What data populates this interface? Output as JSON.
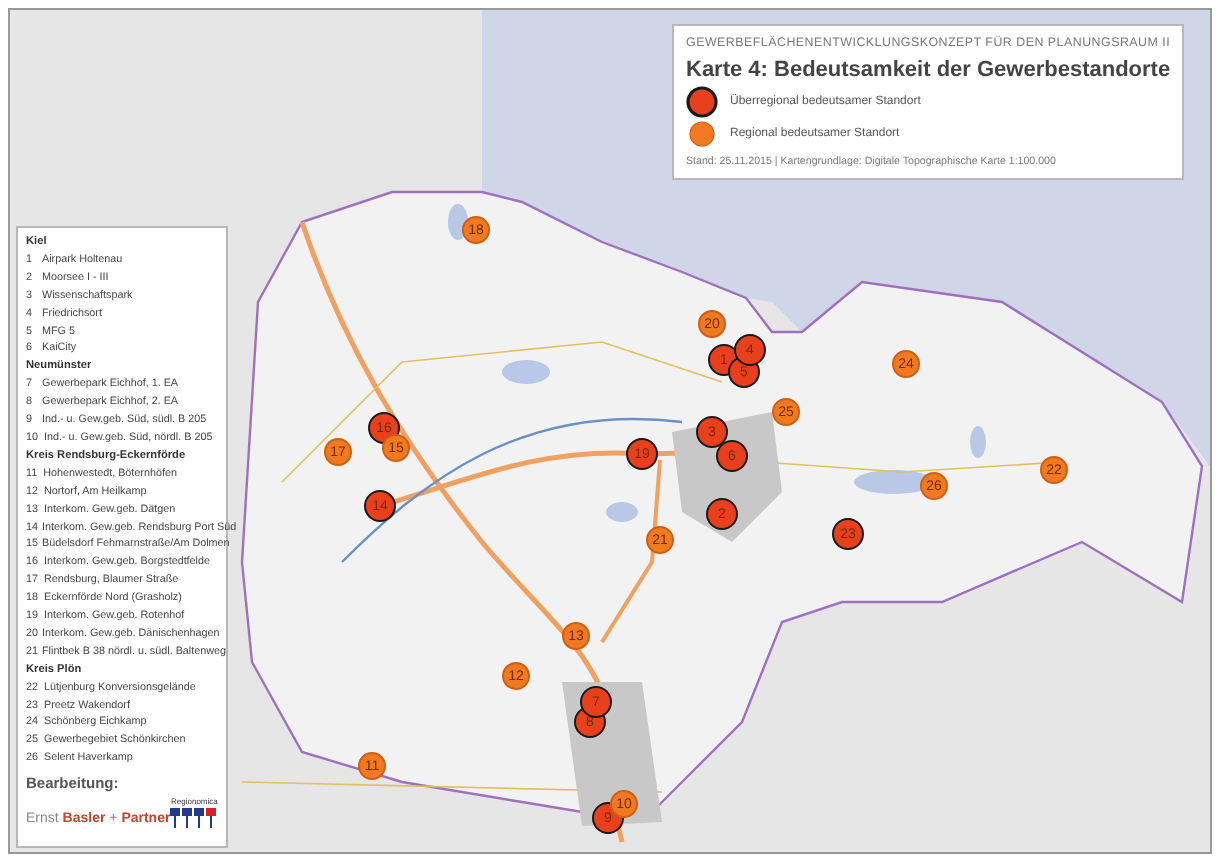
{
  "title_card": {
    "series": "GEWERBEFLÄCHENENTWICKLUNGSKONZEPT FÜR DEN PLANUNGSRAUM II",
    "title": "Karte 4: Bedeutsamkeit der Gewerbestandorte",
    "legend": [
      {
        "kind": "overregional",
        "label": "Überregional bedeutsamer Standort"
      },
      {
        "kind": "regional",
        "label": "Regional bedeutsamer Standort"
      }
    ],
    "note": "Stand: 25.11.2015 | Kartengrundlage: Digitale Topographische Karte 1:100.000"
  },
  "site_list": {
    "groups": [
      {
        "heading": "Kiel",
        "items": [
          {
            "number": "1",
            "label": "Airpark Holtenau"
          },
          {
            "number": "2",
            "label": "Moorsee I - III"
          },
          {
            "number": "3",
            "label": "Wissenschaftspark"
          },
          {
            "number": "4",
            "label": "Friedrichsort"
          },
          {
            "number": "5",
            "label": "MFG 5"
          },
          {
            "number": "6",
            "label": "KaiCity"
          }
        ]
      },
      {
        "heading": "Neumünster",
        "items": [
          {
            "number": "7",
            "label": "Gewerbepark Eichhof, 1. EA"
          },
          {
            "number": "8",
            "label": "Gewerbepark Eichhof, 2. EA"
          },
          {
            "number": "9",
            "label": "Ind.- u. Gew.geb. Süd, südl. B 205"
          },
          {
            "number": "10",
            "label": "Ind.- u. Gew.geb. Süd, nördl. B 205"
          }
        ]
      },
      {
        "heading": "Kreis Rendsburg-Eckernförde",
        "items": [
          {
            "number": "11",
            "label": "Hohenwestedt, Böternhöfen"
          },
          {
            "number": "12",
            "label": "Nortorf, Am Heilkamp"
          },
          {
            "number": "13",
            "label": "Interkom. Gew.geb. Dätgen"
          },
          {
            "number": "14",
            "label": "Interkom. Gew.geb. Rendsburg Port Süd"
          },
          {
            "number": "15",
            "label": "Büdelsdorf Fehmarnstraße/Am Dolmen"
          },
          {
            "number": "16",
            "label": "Interkom. Gew.geb. Borgstedtfelde"
          },
          {
            "number": "17",
            "label": "Rendsburg, Blaumer Straße"
          },
          {
            "number": "18",
            "label": "Eckernförde Nord (Grasholz)"
          },
          {
            "number": "19",
            "label": "Interkom. Gew.geb. Rotenhof"
          },
          {
            "number": "20",
            "label": "Interkom. Gew.geb. Dänischenhagen"
          },
          {
            "number": "21",
            "label": "Flintbek B 38 nördl. u. südl. Baltenweg"
          }
        ]
      },
      {
        "heading": "Kreis Plön",
        "items": [
          {
            "number": "22",
            "label": "Lütjenburg Konversionsgelände"
          },
          {
            "number": "23",
            "label": "Preetz Wakendorf"
          },
          {
            "number": "24",
            "label": "Schönberg Eichkamp"
          },
          {
            "number": "25",
            "label": "Gewerbegebiet Schönkirchen"
          },
          {
            "number": "26",
            "label": "Selent Haverkamp"
          }
        ]
      }
    ],
    "credit_label": "Bearbeitung:",
    "credit_firm": "Ernst **Basler** + **Partner**",
    "credit_partner": "Regionomica"
  },
  "markers": [
    {
      "number": "18",
      "kind": "regional"
    },
    {
      "number": "20",
      "kind": "regional"
    },
    {
      "number": "1",
      "kind": "overregional"
    },
    {
      "number": "5",
      "kind": "overregional"
    },
    {
      "number": "4",
      "kind": "overregional"
    },
    {
      "number": "24",
      "kind": "regional"
    },
    {
      "number": "25",
      "kind": "regional"
    },
    {
      "number": "17",
      "kind": "regional"
    },
    {
      "number": "16",
      "kind": "overregional"
    },
    {
      "number": "15",
      "kind": "regional"
    },
    {
      "number": "19",
      "kind": "overregional"
    },
    {
      "number": "3",
      "kind": "overregional"
    },
    {
      "number": "6",
      "kind": "overregional"
    },
    {
      "number": "22",
      "kind": "regional"
    },
    {
      "number": "26",
      "kind": "regional"
    },
    {
      "number": "14",
      "kind": "overregional"
    },
    {
      "number": "2",
      "kind": "overregional"
    },
    {
      "number": "21",
      "kind": "regional"
    },
    {
      "number": "23",
      "kind": "overregional"
    },
    {
      "number": "13",
      "kind": "regional"
    },
    {
      "number": "12",
      "kind": "regional"
    },
    {
      "number": "8",
      "kind": "overregional"
    },
    {
      "number": "7",
      "kind": "overregional"
    },
    {
      "number": "11",
      "kind": "regional"
    },
    {
      "number": "9",
      "kind": "overregional"
    },
    {
      "number": "10",
      "kind": "regional"
    }
  ]
}
